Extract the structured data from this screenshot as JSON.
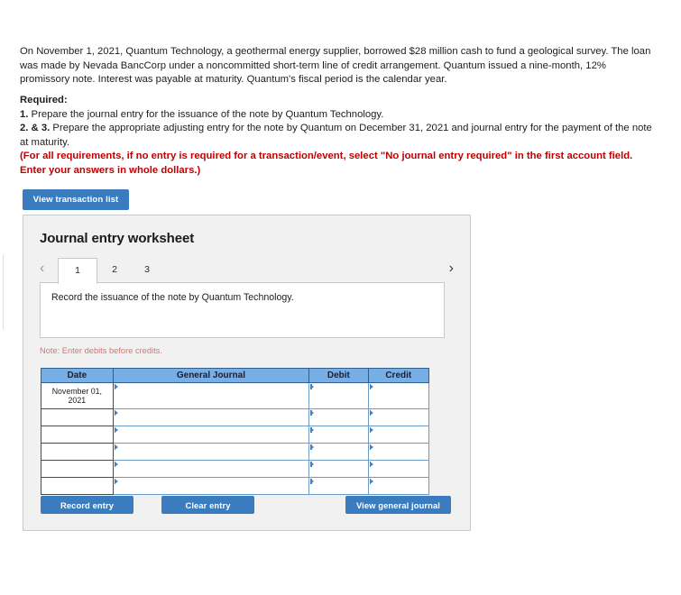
{
  "problem": {
    "text": "On November 1, 2021, Quantum Technology, a geothermal energy supplier, borrowed $28 million cash to fund a geological survey. The loan was made by Nevada BancCorp under a noncommitted short-term line of credit arrangement. Quantum issued a nine-month, 12% promissory note. Interest was payable at maturity. Quantum's fiscal period is the calendar year."
  },
  "required": {
    "title": "Required:",
    "item1_num": "1.",
    "item1_text": " Prepare the journal entry for the issuance of the note by Quantum Technology.",
    "item2_num": "2. & 3.",
    "item2_text": " Prepare the appropriate adjusting entry for the note by Quantum on December 31, 2021 and journal entry for the payment of the note at maturity.",
    "red_note": "(For all requirements, if no entry is required for a transaction/event, select \"No journal entry required\" in the first account field. Enter your answers in whole dollars.)"
  },
  "toolbar": {
    "view_transaction_list_label": "View transaction list"
  },
  "worksheet": {
    "title": "Journal entry worksheet",
    "prev_arrow": "‹",
    "next_arrow": "›",
    "tabs": [
      {
        "label": "1",
        "active": true
      },
      {
        "label": "2",
        "active": false
      },
      {
        "label": "3",
        "active": false
      }
    ],
    "instruction": "Record the issuance of the note by Quantum Technology.",
    "debit_note": "Note: Enter debits before credits.",
    "table": {
      "headers": [
        "Date",
        "General Journal",
        "Debit",
        "Credit"
      ],
      "rows": [
        {
          "date": "November 01, 2021",
          "general_journal": "",
          "debit": "",
          "credit": ""
        },
        {
          "date": "",
          "general_journal": "",
          "debit": "",
          "credit": ""
        },
        {
          "date": "",
          "general_journal": "",
          "debit": "",
          "credit": ""
        },
        {
          "date": "",
          "general_journal": "",
          "debit": "",
          "credit": ""
        },
        {
          "date": "",
          "general_journal": "",
          "debit": "",
          "credit": ""
        },
        {
          "date": "",
          "general_journal": "",
          "debit": "",
          "credit": ""
        }
      ]
    },
    "buttons": {
      "record_entry": "Record entry",
      "clear_entry": "Clear entry",
      "view_general_journal": "View general journal"
    }
  },
  "colors": {
    "button_blue": "#3a7cbe",
    "table_header_blue": "#78aee6",
    "red_text": "#c00000",
    "note_red": "#d9736e",
    "card_gray": "#f1f1f1"
  }
}
